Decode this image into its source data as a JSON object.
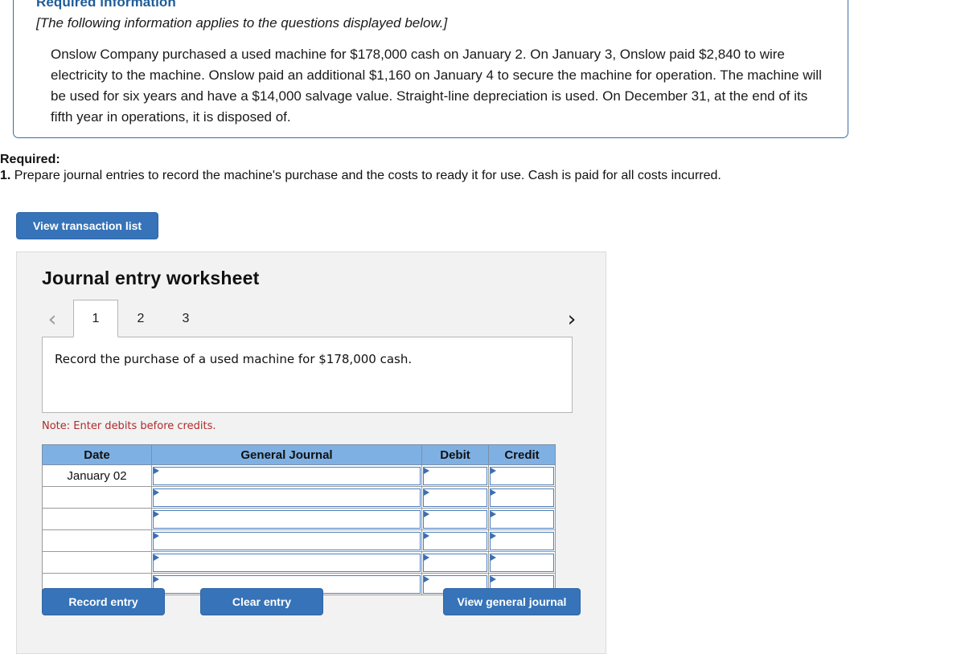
{
  "info_box": {
    "title": "Required information",
    "bracket_note": "[The following information applies to the questions displayed below.]",
    "paragraph": "Onslow Company purchased a used machine for $178,000 cash on January 2. On January 3, Onslow paid $2,840 to wire electricity to the machine. Onslow paid an additional $1,160 on January 4 to secure the machine for operation. The machine will be used for six years and have a $14,000 salvage value. Straight-line depreciation is used. On December 31, at the end of its fifth year in operations, it is disposed of."
  },
  "required": {
    "label": "Required:",
    "number": "1.",
    "text": "Prepare journal entries to record the machine's purchase and the costs to ready it for use. Cash is paid for all costs incurred."
  },
  "actions": {
    "view_transaction_list": "View transaction list",
    "record_entry": "Record entry",
    "clear_entry": "Clear entry",
    "view_general_journal": "View general journal"
  },
  "worksheet": {
    "title": "Journal entry worksheet",
    "prev_icon": "chevron-left",
    "next_icon": "chevron-right",
    "tabs": [
      {
        "label": "1",
        "active": true
      },
      {
        "label": "2",
        "active": false
      },
      {
        "label": "3",
        "active": false
      }
    ],
    "description": "Record the purchase of a used machine for $178,000 cash.",
    "note": "Note: Enter debits before credits.",
    "table": {
      "headers": [
        "Date",
        "General Journal",
        "Debit",
        "Credit"
      ],
      "rows": [
        {
          "date": "January 02",
          "general_journal": "",
          "debit": "",
          "credit": ""
        },
        {
          "date": "",
          "general_journal": "",
          "debit": "",
          "credit": ""
        },
        {
          "date": "",
          "general_journal": "",
          "debit": "",
          "credit": ""
        },
        {
          "date": "",
          "general_journal": "",
          "debit": "",
          "credit": ""
        },
        {
          "date": "",
          "general_journal": "",
          "debit": "",
          "credit": ""
        },
        {
          "date": "",
          "general_journal": "",
          "debit": "",
          "credit": ""
        }
      ]
    }
  },
  "colors": {
    "accent_blue": "#3673b8",
    "table_header_blue": "#7fb0e3",
    "heading_blue": "#1f5c99",
    "note_red": "#b02b2b",
    "panel_gray": "#f2f2f2"
  }
}
